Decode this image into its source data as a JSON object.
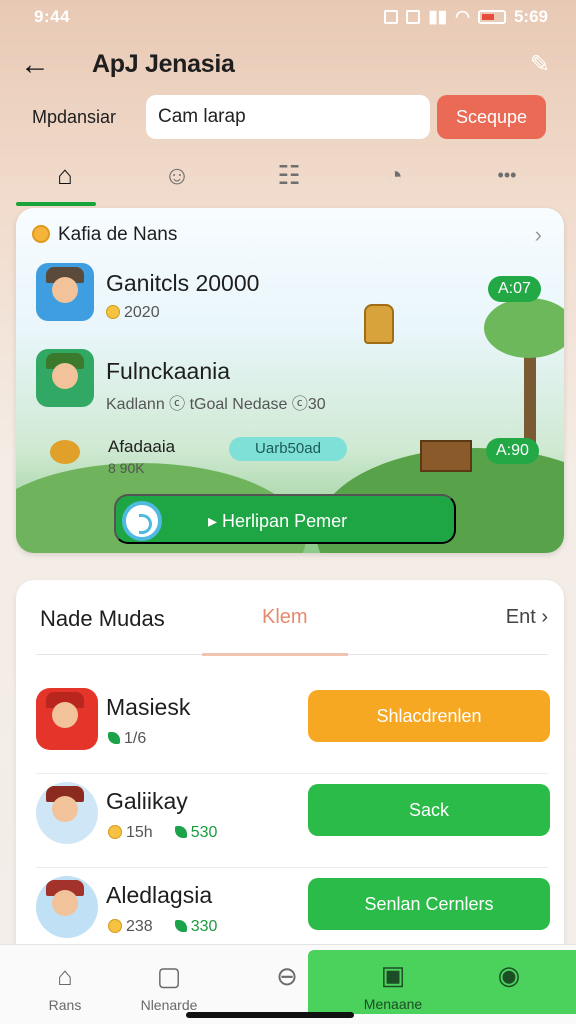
{
  "status": {
    "time": "9:44",
    "right_time": "5:69"
  },
  "appbar": {
    "title": "ApJ Jenasia"
  },
  "search": {
    "label": "Mpdansiar",
    "value": "Cam larap",
    "button": "Scequpe"
  },
  "tabs": [
    {
      "icon": "home-icon",
      "glyph": "⌂"
    },
    {
      "icon": "user-icon",
      "glyph": "☺"
    },
    {
      "icon": "list-icon",
      "glyph": "☷"
    },
    {
      "icon": "compass-icon",
      "glyph": "◔"
    },
    {
      "icon": "more-icon",
      "glyph": "•••"
    }
  ],
  "featured": {
    "header": "Kafia de Nans",
    "games": [
      {
        "name": "Ganitcls 20000",
        "sub": "2020",
        "price": "A:07"
      },
      {
        "name": "Fulnckaania",
        "sub": "Kadlann ⓒ tGoal Nedase ⓒ30"
      },
      {
        "name": "Afadaaia",
        "sub": "8 90K",
        "pill": "Uarb50ad",
        "price": "A:90"
      }
    ],
    "play_button": "Herlipan Pemer"
  },
  "list_card": {
    "title": "Nade Mudas",
    "middle": "Klem",
    "edit": "Ent",
    "items": [
      {
        "name": "Masiesk",
        "meta1": "1/6",
        "meta2": "",
        "button": "Shlacdrenlen",
        "button_color": "#f7a823"
      },
      {
        "name": "Galiikay",
        "meta1": "15h",
        "meta2": "530",
        "button": "Sack",
        "button_color": "#2abb48"
      },
      {
        "name": "Aledlagsia",
        "meta1": "238",
        "meta2": "330",
        "button": "Senlan Cernlers",
        "button_color": "#2abb48"
      }
    ]
  },
  "bottom_nav": [
    {
      "icon": "home-icon",
      "label": "Rans"
    },
    {
      "icon": "card-icon",
      "label": "Nlenarde"
    },
    {
      "icon": "compass-icon",
      "label": ""
    },
    {
      "icon": "chest-icon",
      "label": "Menaane"
    },
    {
      "icon": "settings-icon",
      "label": ""
    }
  ]
}
